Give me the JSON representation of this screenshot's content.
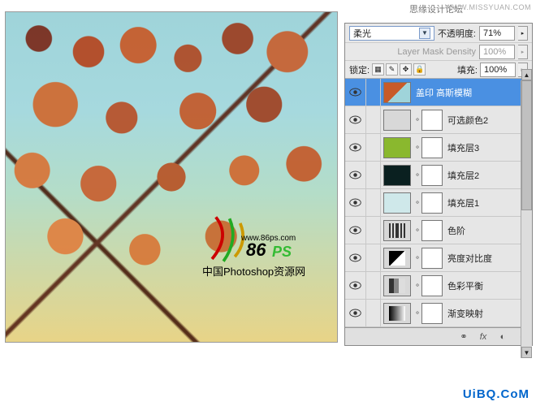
{
  "header": {
    "forum": "思缘设计论坛",
    "site": "WWW.MISSYUAN.COM"
  },
  "watermark": {
    "url": "www.86ps.com",
    "brand_num": "86",
    "brand_ps": "PS",
    "cn": "中国Photoshop资源网"
  },
  "panel": {
    "blend_mode": "柔光",
    "opacity_label": "不透明度:",
    "opacity_value": "71%",
    "mask_density_label": "Layer Mask Density",
    "mask_density_value": "100%",
    "lock_label": "锁定:",
    "fill_label": "填充:",
    "fill_value": "100%"
  },
  "layers": [
    {
      "name": "盖印 高斯模糊",
      "type": "img",
      "selected": true
    },
    {
      "name": "可选颜色2",
      "type": "adj",
      "icon": "sel"
    },
    {
      "name": "填充层3",
      "type": "fill",
      "swatch": "green"
    },
    {
      "name": "填充层2",
      "type": "fill",
      "swatch": "dark"
    },
    {
      "name": "填充层1",
      "type": "fill",
      "swatch": "light"
    },
    {
      "name": "色阶",
      "type": "adj",
      "icon": "levels"
    },
    {
      "name": "亮度对比度",
      "type": "adj",
      "icon": "bc"
    },
    {
      "name": "色彩平衡",
      "type": "adj",
      "icon": "bal"
    },
    {
      "name": "渐变映射",
      "type": "adj",
      "icon": "grad"
    }
  ],
  "footer_brand": "UiBQ.CoM"
}
